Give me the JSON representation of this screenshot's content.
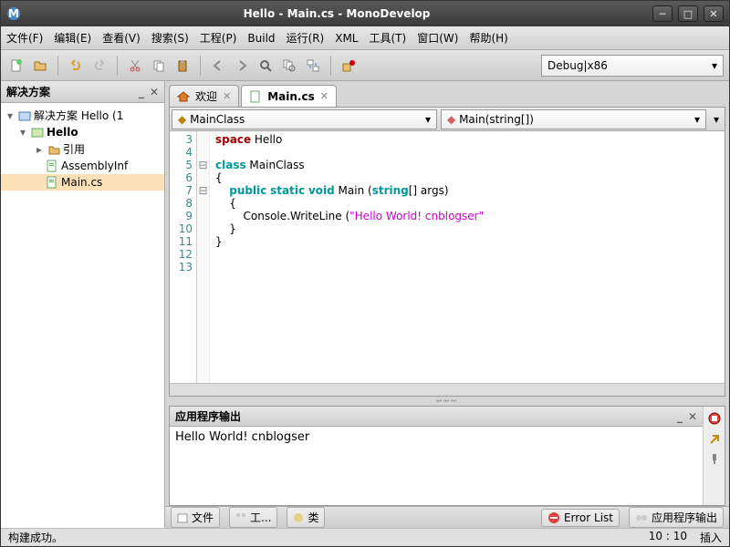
{
  "title": "Hello - Main.cs - MonoDevelop",
  "menu": {
    "file": "文件(F)",
    "edit": "编辑(E)",
    "view": "查看(V)",
    "search": "搜索(S)",
    "project": "工程(P)",
    "build": "Build",
    "run": "运行(R)",
    "xml": "XML",
    "tools": "工具(T)",
    "window": "窗口(W)",
    "help": "帮助(H)"
  },
  "config": "Debug|x86",
  "sidebar": {
    "title": "解决方案",
    "sln": "解决方案 Hello (1",
    "proj": "Hello",
    "refs": "引用",
    "asm": "AssemblyInf",
    "main": "Main.cs"
  },
  "tabs": {
    "welcome": "欢迎",
    "main": "Main.cs"
  },
  "nav": {
    "class": "MainClass",
    "method": "Main(string[])"
  },
  "code": {
    "lines": [
      "3",
      "4",
      "5",
      "6",
      "7",
      "8",
      "9",
      "10",
      "11",
      "12",
      "13"
    ],
    "l3_kw": "space",
    "l3_rest": " Hello",
    "l5_kw": "class",
    "l5_rest": " MainClass",
    "l6": "{",
    "l7_a": "    ",
    "l7_pub": "public",
    "l7_sp1": " ",
    "l7_stat": "static",
    "l7_sp2": " ",
    "l7_void": "void",
    "l7_mid": " Main (",
    "l7_str": "string",
    "l7_end": "[] args)",
    "l8": "    {",
    "l9_a": "        Console.WriteLine (",
    "l9_str": "\"Hello World! cnblogser\"",
    "l10": "    }",
    "l11": "}"
  },
  "output": {
    "title": "应用程序输出",
    "text": "Hello World! cnblogser"
  },
  "bottom": {
    "files": "文件",
    "tools": "工...",
    "classes": "类",
    "errors": "Error List",
    "appout": "应用程序输出"
  },
  "status": {
    "msg": "构建成功。",
    "pos": "10 : 10",
    "mode": "插入"
  }
}
